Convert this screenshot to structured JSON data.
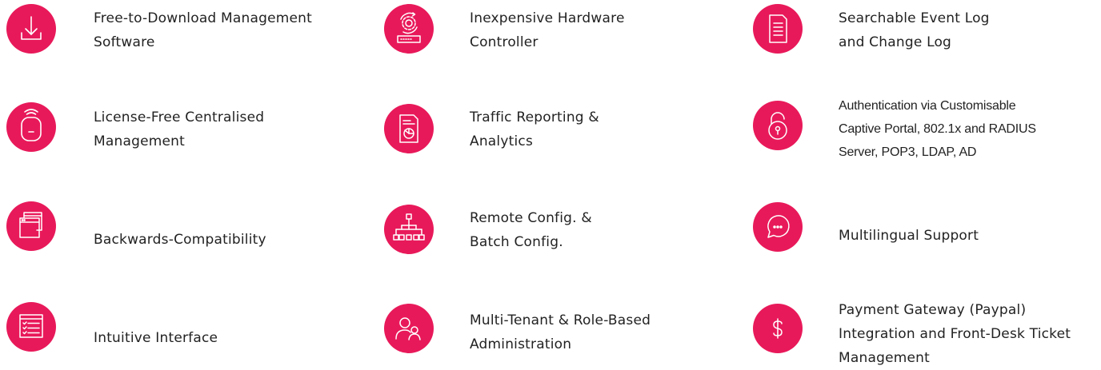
{
  "accent_color": "#e8195a",
  "features": {
    "col1": [
      {
        "icon": "download-icon",
        "lines": [
          "Free-to-Download Management",
          "Software"
        ]
      },
      {
        "icon": "wireless-access-point-icon",
        "lines": [
          "License-Free Centralised",
          "Management"
        ]
      },
      {
        "icon": "stacked-windows-icon",
        "lines": [
          "Backwards-Compatibility"
        ]
      },
      {
        "icon": "interface-checklist-icon",
        "lines": [
          "Intuitive Interface"
        ]
      }
    ],
    "col2": [
      {
        "icon": "hardware-controller-icon",
        "lines": [
          "Inexpensive Hardware",
          "Controller"
        ]
      },
      {
        "icon": "report-document-icon",
        "lines": [
          "Traffic Reporting &",
          "Analytics"
        ]
      },
      {
        "icon": "hierarchy-tree-icon",
        "lines": [
          "Remote Config. &",
          "Batch Config."
        ]
      },
      {
        "icon": "users-icon",
        "lines": [
          "Multi-Tenant & Role-Based",
          "Administration"
        ]
      }
    ],
    "col3": [
      {
        "icon": "event-log-document-icon",
        "lines": [
          "Searchable Event Log",
          "and Change Log"
        ]
      },
      {
        "icon": "padlock-icon",
        "lines": [
          "Authentication via Customisable",
          "Captive Portal, 802.1x and RADIUS",
          "Server, POP3, LDAP, AD"
        ]
      },
      {
        "icon": "chat-bubble-icon",
        "lines": [
          "Multilingual Support"
        ]
      },
      {
        "icon": "dollar-icon",
        "lines": [
          "Payment Gateway (Paypal)",
          "Integration and Front-Desk Ticket",
          "Management"
        ]
      }
    ]
  }
}
